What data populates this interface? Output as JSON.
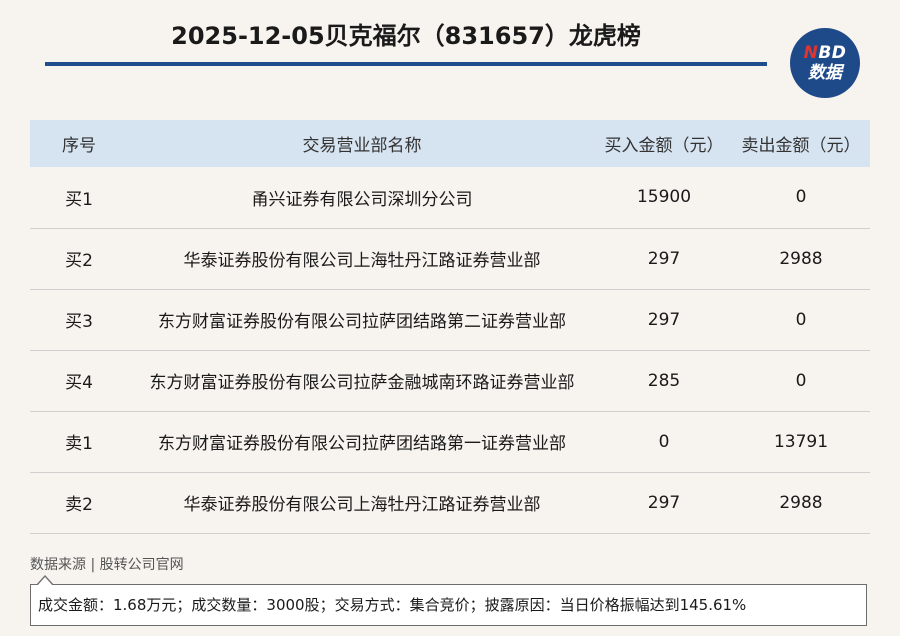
{
  "header": {
    "title": "2025-12-05贝克福尔（831657）龙虎榜"
  },
  "logo": {
    "line1_n": "N",
    "line1_rest": "BD",
    "line2": "数据"
  },
  "table": {
    "columns": [
      "序号",
      "交易营业部名称",
      "买入金额（元）",
      "卖出金额（元）"
    ],
    "rows": [
      [
        "买1",
        "甬兴证券有限公司深圳分公司",
        "15900",
        "0"
      ],
      [
        "买2",
        "华泰证券股份有限公司上海牡丹江路证券营业部",
        "297",
        "2988"
      ],
      [
        "买3",
        "东方财富证券股份有限公司拉萨团结路第二证券营业部",
        "297",
        "0"
      ],
      [
        "买4",
        "东方财富证券股份有限公司拉萨金融城南环路证券营业部",
        "285",
        "0"
      ],
      [
        "卖1",
        "东方财富证券股份有限公司拉萨团结路第一证券营业部",
        "0",
        "13791"
      ],
      [
        "卖2",
        "华泰证券股份有限公司上海牡丹江路证券营业部",
        "297",
        "2988"
      ]
    ]
  },
  "footer": {
    "source": "数据来源 | 股转公司官网",
    "note": "成交金额：1.68万元；成交数量：3000股；交易方式：集合竞价；披露原因：当日价格振幅达到145.61%"
  },
  "colors": {
    "accent": "#1f4e8c",
    "header_row": "#d6e3f0",
    "background": "#f7f4ef",
    "logo_red": "#e2342f"
  }
}
